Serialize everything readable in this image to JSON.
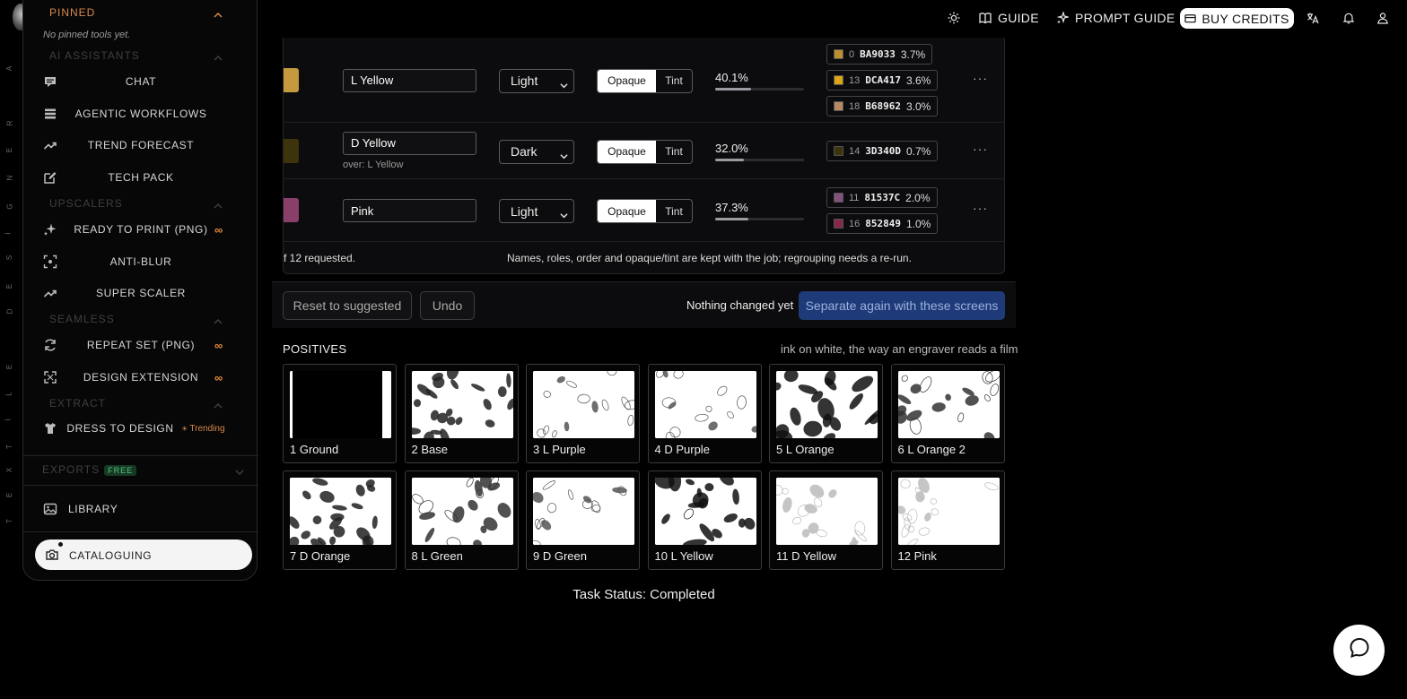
{
  "left_strip_letters": [
    "A",
    "R",
    "E",
    "N",
    "G",
    "I",
    "S",
    "E",
    "D",
    "E",
    "L",
    "I",
    "T",
    "X",
    "E",
    "T"
  ],
  "sidebar": {
    "pinned": {
      "label": "PINNED",
      "empty_note": "No pinned tools yet."
    },
    "sections": [
      {
        "label": "AI ASSISTANTS",
        "items": [
          {
            "label": "CHAT",
            "icon": "chat-icon"
          },
          {
            "label": "AGENTIC WORKFLOWS",
            "icon": "workflow-icon"
          },
          {
            "label": "TREND FORECAST",
            "icon": "trend-icon"
          },
          {
            "label": "TECH PACK",
            "icon": "edit-icon"
          }
        ]
      },
      {
        "label": "UPSCALERS",
        "items": [
          {
            "label": "READY TO PRINT (PNG)",
            "icon": "sparkle-icon",
            "infinite": "∞"
          },
          {
            "label": "ANTI-BLUR",
            "icon": "focus-icon"
          },
          {
            "label": "SUPER SCALER",
            "icon": "trend-icon"
          }
        ]
      },
      {
        "label": "SEAMLESS",
        "items": [
          {
            "label": "REPEAT SET (PNG)",
            "icon": "repeat-icon",
            "infinite": "∞"
          },
          {
            "label": "DESIGN EXTENSION",
            "icon": "expand-icon",
            "infinite": "∞"
          }
        ]
      },
      {
        "label": "EXTRACT",
        "items": [
          {
            "label": "DRESS TO DESIGN",
            "icon": "shirt-icon",
            "tag": "Trending"
          }
        ]
      }
    ],
    "exports": {
      "label": "EXPORTS",
      "badge": "FREE"
    },
    "library": {
      "label": "LIBRARY"
    },
    "cataloguing": {
      "label": "CATALOGUING"
    }
  },
  "topnav": {
    "guide": "GUIDE",
    "prompt_guide": "PROMPT GUIDE",
    "buy_credits": "BUY CREDITS"
  },
  "screens": [
    {
      "name": "L Yellow",
      "over": "",
      "role": "Light",
      "mode_opaque": "Opaque",
      "mode_tint": "Tint",
      "coverage": "40.1%",
      "coverage_value": 40.1,
      "color": "#C59A3E",
      "chips": [
        {
          "idx": "0",
          "hex": "BA9033",
          "pct": "3.7%",
          "color": "#BA9033"
        },
        {
          "idx": "13",
          "hex": "DCA417",
          "pct": "3.6%",
          "color": "#DCA417"
        },
        {
          "idx": "18",
          "hex": "B68962",
          "pct": "3.0%",
          "color": "#B68962"
        }
      ]
    },
    {
      "name": "D Yellow",
      "over": "over: L Yellow",
      "role": "Dark",
      "mode_opaque": "Opaque",
      "mode_tint": "Tint",
      "coverage": "32.0%",
      "coverage_value": 32.0,
      "color": "#3D340D",
      "chips": [
        {
          "idx": "14",
          "hex": "3D340D",
          "pct": "0.7%",
          "color": "#3D340D"
        }
      ]
    },
    {
      "name": "Pink",
      "over": "",
      "role": "Light",
      "mode_opaque": "Opaque",
      "mode_tint": "Tint",
      "coverage": "37.3%",
      "coverage_value": 37.3,
      "color": "#8A3F6A",
      "chips": [
        {
          "idx": "11",
          "hex": "81537C",
          "pct": "2.0%",
          "color": "#81537C"
        },
        {
          "idx": "16",
          "hex": "852849",
          "pct": "1.0%",
          "color": "#852849"
        }
      ]
    }
  ],
  "panel_footer": {
    "left": "f 12 requested.",
    "right": "Names, roles, order and opaque/tint are kept with the job; regrouping needs a re-run."
  },
  "actions": {
    "reset": "Reset to suggested",
    "undo": "Undo",
    "status": "Nothing changed yet",
    "separate": "Separate again with these screens"
  },
  "positives": {
    "title": "POSITIVES",
    "subtitle": "ink on white, the way an engraver reads a film",
    "tiles": [
      {
        "label": "1 Ground",
        "pattern": "ground"
      },
      {
        "label": "2 Base",
        "pattern": "leaves"
      },
      {
        "label": "3 L Purple",
        "pattern": "sparse"
      },
      {
        "label": "4 D Purple",
        "pattern": "sparse"
      },
      {
        "label": "5 L Orange",
        "pattern": "dark"
      },
      {
        "label": "6 L Orange 2",
        "pattern": "medium"
      },
      {
        "label": "7 D Orange",
        "pattern": "leaves"
      },
      {
        "label": "8 L Green",
        "pattern": "medium"
      },
      {
        "label": "9 D Green",
        "pattern": "sparse"
      },
      {
        "label": "10 L Yellow",
        "pattern": "dark"
      },
      {
        "label": "11 D Yellow",
        "pattern": "faint"
      },
      {
        "label": "12 Pink",
        "pattern": "faint"
      }
    ]
  },
  "task_status": "Task Status: Completed"
}
